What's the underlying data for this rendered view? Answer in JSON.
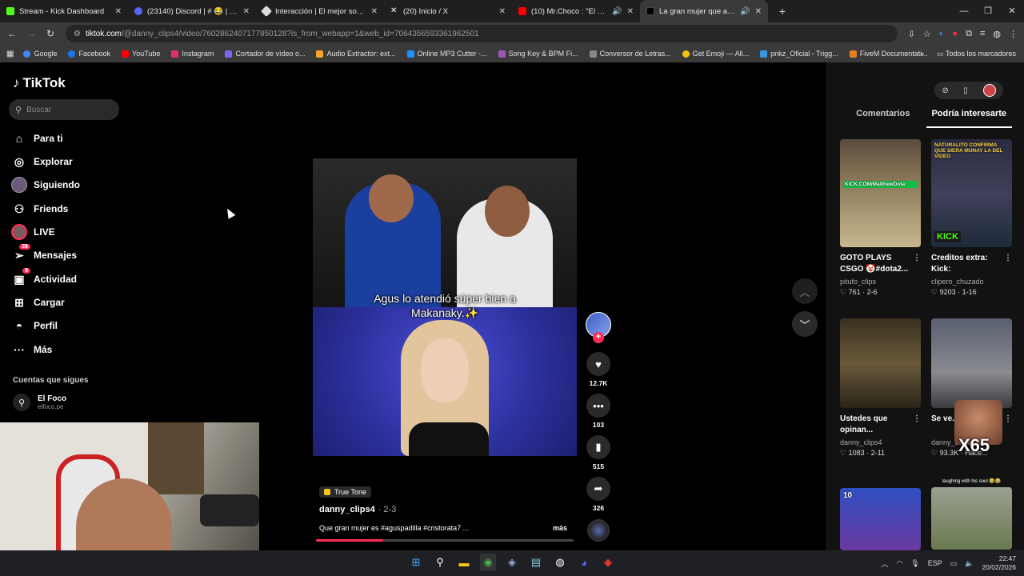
{
  "browser": {
    "tabs": [
      {
        "title": "Stream - Kick Dashboard",
        "color": "#53fc18"
      },
      {
        "title": "(23140) Discord | # 😂 | MEMES |",
        "color": "#5865f2"
      },
      {
        "title": "Interacción | El mejor software",
        "color": "#dddddd"
      },
      {
        "title": "(20) Inicio / X",
        "color": "#ffffff"
      },
      {
        "title": "(10) Mr.Choco : \"El Courier y El",
        "color": "#ff0000"
      },
      {
        "title": "La gran mujer que atendió",
        "color": "#ffffff"
      }
    ],
    "url_domain": "tiktok.com",
    "url_rest": "/@danny_clips4/video/7602862407177850128?is_from_webapp=1&web_id=7064356593361962501",
    "bookmarks": [
      {
        "label": "Google",
        "color": "#4285f4"
      },
      {
        "label": "Facebook",
        "color": "#1877f2"
      },
      {
        "label": "YouTube",
        "color": "#ff0000"
      },
      {
        "label": "Instagram",
        "color": "#e1306c"
      },
      {
        "label": "Cortador de vídeo o...",
        "color": "#7b68ee"
      },
      {
        "label": "Audio Extractor: ext...",
        "color": "#f5a623"
      },
      {
        "label": "Online MP3 Cutter -...",
        "color": "#1e90ff"
      },
      {
        "label": "Song Key & BPM Fi...",
        "color": "#9b59b6"
      },
      {
        "label": "Conversor de Letras...",
        "color": "#888888"
      },
      {
        "label": "Get Emoji — All...",
        "color": "#f1c40f"
      },
      {
        "label": "pnkz_Oficial - Trigg...",
        "color": "#3498db"
      },
      {
        "label": "FiveM Documentati...",
        "color": "#e67e22"
      }
    ],
    "all_bookmarks": "Todos los marcadores"
  },
  "tiktok": {
    "logo": "TikTok",
    "search_placeholder": "Buscar",
    "nav": [
      {
        "label": "Para ti",
        "icon": "home-icon",
        "glyph": "⌂"
      },
      {
        "label": "Explorar",
        "icon": "compass-icon",
        "glyph": "◎"
      },
      {
        "label": "Siguiendo",
        "icon": "following-avatar-icon",
        "glyph": "●"
      },
      {
        "label": "Friends",
        "icon": "friends-icon",
        "glyph": "⚇"
      },
      {
        "label": "LIVE",
        "icon": "live-icon",
        "glyph": "◉"
      },
      {
        "label": "Mensajes",
        "icon": "messages-icon",
        "glyph": "➢",
        "badge": "26"
      },
      {
        "label": "Actividad",
        "icon": "activity-icon",
        "glyph": "▣",
        "badge": "9"
      },
      {
        "label": "Cargar",
        "icon": "upload-icon",
        "glyph": "⊞"
      },
      {
        "label": "Perfil",
        "icon": "profile-icon",
        "glyph": "◓"
      },
      {
        "label": "Más",
        "icon": "more-icon",
        "glyph": "···"
      }
    ],
    "following_title": "Cuentas que sigues",
    "following_account": {
      "name": "El Foco",
      "handle": "elfoco.pe"
    },
    "video": {
      "caption_line1": "Agus lo atendió súper bien a",
      "caption_line2": "Makanaky.✨",
      "tag": "True Tone",
      "author": "danny_clips4",
      "date": "· 2-3",
      "description": "Que gran mujer es #aguspadilla #cristorata7 ...",
      "more": "más",
      "progress": 0.26
    },
    "actions": {
      "likes": "12.7K",
      "comments": "103",
      "saves": "515",
      "shares": "326"
    },
    "right_panel": {
      "tab_comments": "Comentarios",
      "tab_suggested": "Podría interesarte",
      "cards": [
        {
          "title": "GOTO PLAYS CSGO 🤡#dota2...",
          "user": "pitufo_clips",
          "likes": "♡ 761",
          "date": "· 2-6",
          "overlay": "KICK.COM/MatthewDota"
        },
        {
          "title": "Creditos extra: Kick: NATURALIT...",
          "user": "clipero_chuzado",
          "likes": "♡ 9203",
          "date": "· 1-16",
          "overlay": "NATURALITO CONFIRMA QUE SIERA MUNAY LA DEL VIDEO",
          "overlay_bottom": "KICK"
        },
        {
          "title": "Ustedes que opinan...",
          "user": "danny_clips4",
          "likes": "♡ 1083",
          "date": "· 2-11",
          "overlay": ""
        },
        {
          "title": "Se ve... a su p...",
          "user": "danny_c...",
          "likes": "♡ 93.3K",
          "date": "· Hace...",
          "overlay": ""
        },
        {
          "title": "",
          "user": "",
          "likes": "",
          "date": "",
          "overlay": "10"
        },
        {
          "title": "",
          "user": "",
          "likes": "",
          "date": "",
          "overlay": "laughing with his soul 😂😂"
        }
      ]
    },
    "meme_overlay": "X65"
  },
  "taskbar": {
    "lang": "ESP",
    "time": "22:47",
    "date": "20/02/2026"
  }
}
